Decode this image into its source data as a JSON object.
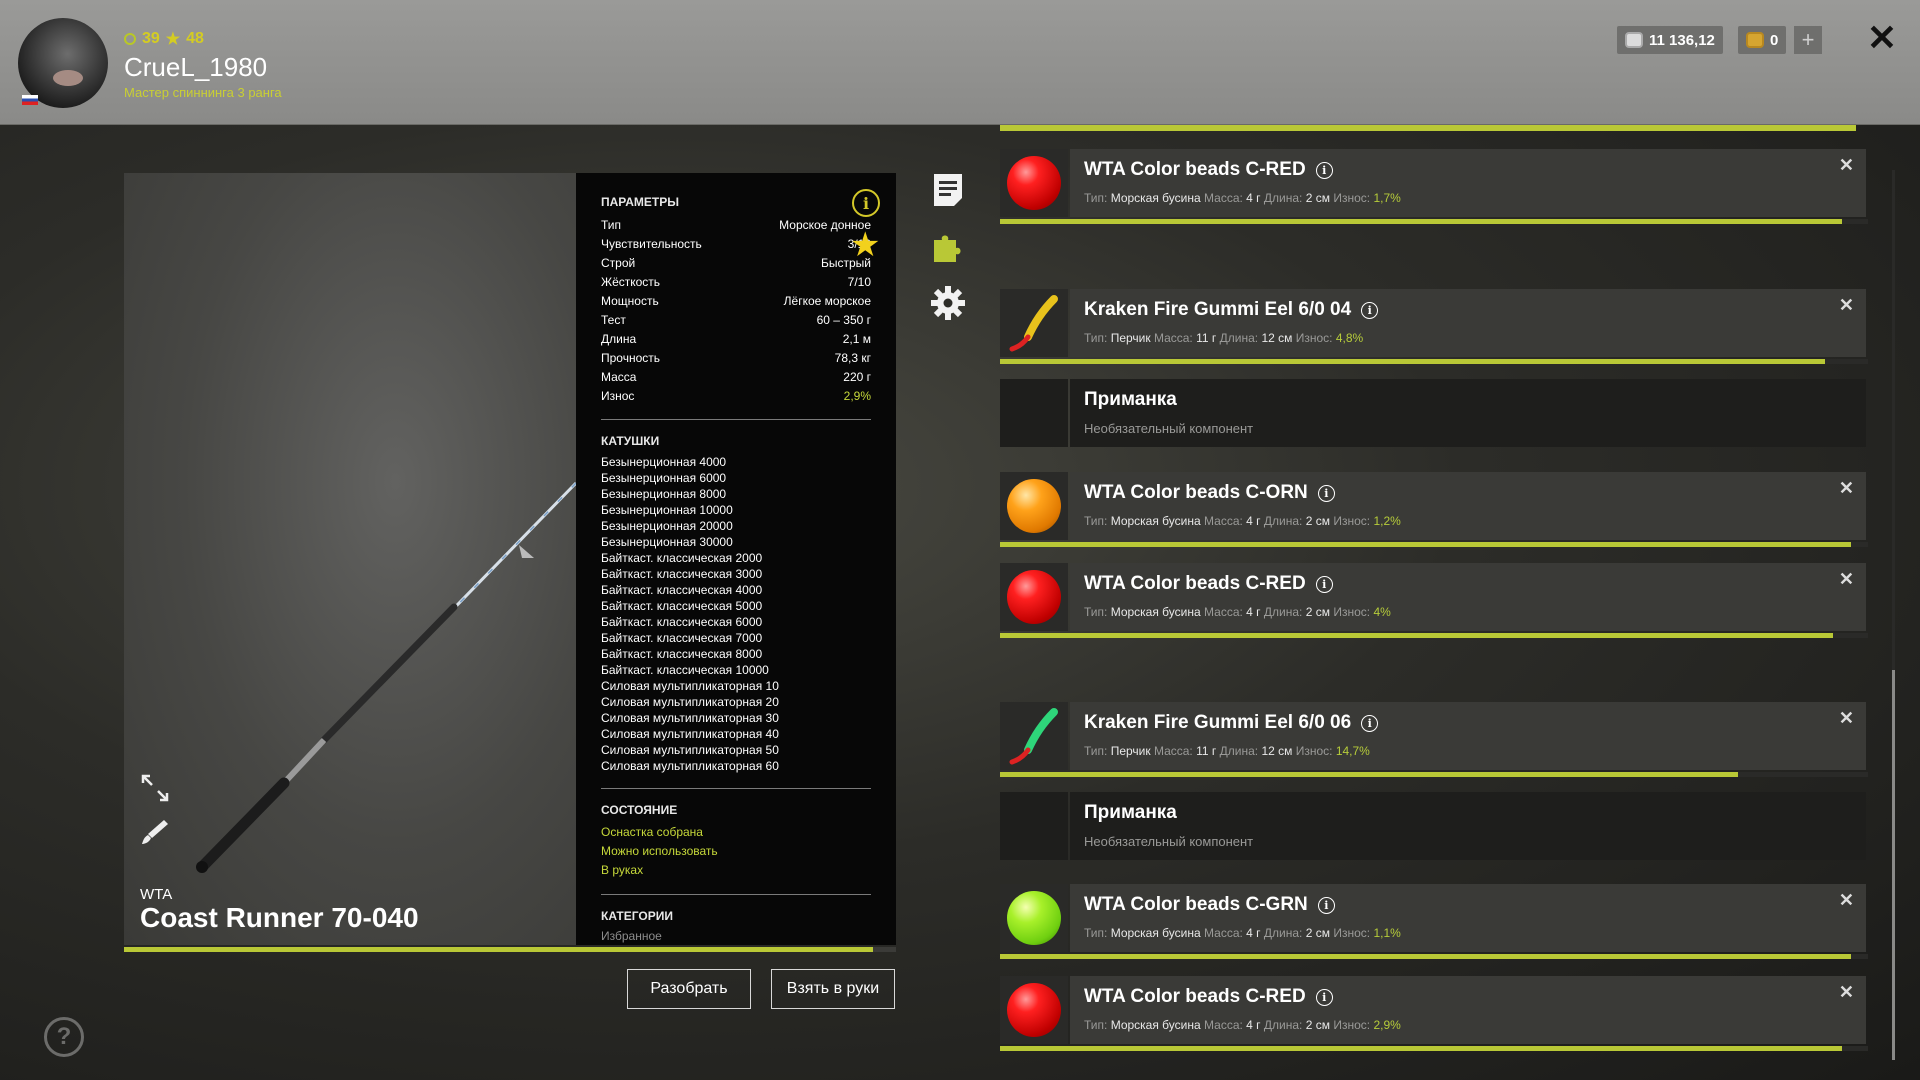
{
  "header": {
    "level": "39",
    "rank_level": "48",
    "username": "CrueL_1980",
    "rank_title": "Мастер спиннинга 3 ранга",
    "silver": "11 136,12",
    "gold": "0"
  },
  "rod": {
    "brand": "WTA",
    "name": "Coast Runner 70-040",
    "wear_fraction": 0.97
  },
  "params": {
    "title": "ПАРАМЕТРЫ",
    "rows": [
      {
        "k": "Тип",
        "v": "Морское донное"
      },
      {
        "k": "Чувствительность",
        "v": "3/10"
      },
      {
        "k": "Строй",
        "v": "Быстрый"
      },
      {
        "k": "Жёсткость",
        "v": "7/10"
      },
      {
        "k": "Мощность",
        "v": "Лёгкое морское"
      },
      {
        "k": "Тест",
        "v": "60 – 350 г"
      },
      {
        "k": "Длина",
        "v": "2,1 м"
      },
      {
        "k": "Прочность",
        "v": "78,3 кг"
      },
      {
        "k": "Масса",
        "v": "220 г"
      },
      {
        "k": "Износ",
        "v": "2,9%"
      }
    ],
    "reels_title": "КАТУШКИ",
    "reels": [
      "Безынерционная 4000",
      "Безынерционная 6000",
      "Безынерционная 8000",
      "Безынерционная 10000",
      "Безынерционная 20000",
      "Безынерционная 30000",
      "Байткаст. классическая 2000",
      "Байткаст. классическая 3000",
      "Байткаст. классическая 4000",
      "Байткаст. классическая 5000",
      "Байткаст. классическая 6000",
      "Байткаст. классическая 7000",
      "Байткаст. классическая 8000",
      "Байткаст. классическая 10000",
      "Силовая мультипликаторная 10",
      "Силовая мультипликаторная 20",
      "Силовая мультипликаторная 30",
      "Силовая мультипликаторная 40",
      "Силовая мультипликаторная 50",
      "Силовая мультипликаторная 60"
    ],
    "state_title": "СОСТОЯНИЕ",
    "states": [
      "Оснастка собрана",
      "Можно использовать",
      "В руках"
    ],
    "categories_title": "КАТЕГОРИИ",
    "categories": [
      "Избранное"
    ]
  },
  "buttons": {
    "disassemble": "Разобрать",
    "take": "Взять в руки"
  },
  "list_labels": {
    "type": "Тип:",
    "mass": "Масса:",
    "length": "Длина:",
    "wear": "Износ:"
  },
  "items": [
    {
      "kind": "bead",
      "color": "red",
      "title": "WTA Color beads C-RED",
      "type": "Морская бусина",
      "mass": "4 г",
      "length": "2 см",
      "wear": "1,7%",
      "condition": 0.97
    },
    {
      "kind": "eel",
      "color": "#e8c21c",
      "title": "Kraken Fire Gummi Eel 6/0 04",
      "type": "Перчик",
      "mass": "11 г",
      "length": "12 см",
      "wear": "4,8%",
      "condition": 0.95
    },
    {
      "kind": "empty",
      "title": "Приманка",
      "sub": "Необязательный компонент"
    },
    {
      "kind": "bead",
      "color": "orange",
      "title": "WTA Color beads C-ORN",
      "type": "Морская бусина",
      "mass": "4 г",
      "length": "2 см",
      "wear": "1,2%",
      "condition": 0.98
    },
    {
      "kind": "bead",
      "color": "red",
      "title": "WTA Color beads C-RED",
      "type": "Морская бусина",
      "mass": "4 г",
      "length": "2 см",
      "wear": "4%",
      "condition": 0.96
    },
    {
      "kind": "eel",
      "color": "#2ed67a",
      "title": "Kraken Fire Gummi Eel 6/0 06",
      "type": "Перчик",
      "mass": "11 г",
      "length": "12 см",
      "wear": "14,7%",
      "condition": 0.85
    },
    {
      "kind": "empty",
      "title": "Приманка",
      "sub": "Необязательный компонент"
    },
    {
      "kind": "bead",
      "color": "green",
      "title": "WTA Color beads C-GRN",
      "type": "Морская бусина",
      "mass": "4 г",
      "length": "2 см",
      "wear": "1,1%",
      "condition": 0.98
    },
    {
      "kind": "bead",
      "color": "red",
      "title": "WTA Color beads C-RED",
      "type": "Морская бусина",
      "mass": "4 г",
      "length": "2 см",
      "wear": "2,9%",
      "condition": 0.97
    }
  ],
  "icons": {
    "notes": "document-icon",
    "components": "puzzle-icon",
    "settings": "gear-icon",
    "info": "info-icon",
    "favorite": "star-icon",
    "help": "help-icon",
    "close": "close-icon"
  },
  "accent": "#b9c836"
}
